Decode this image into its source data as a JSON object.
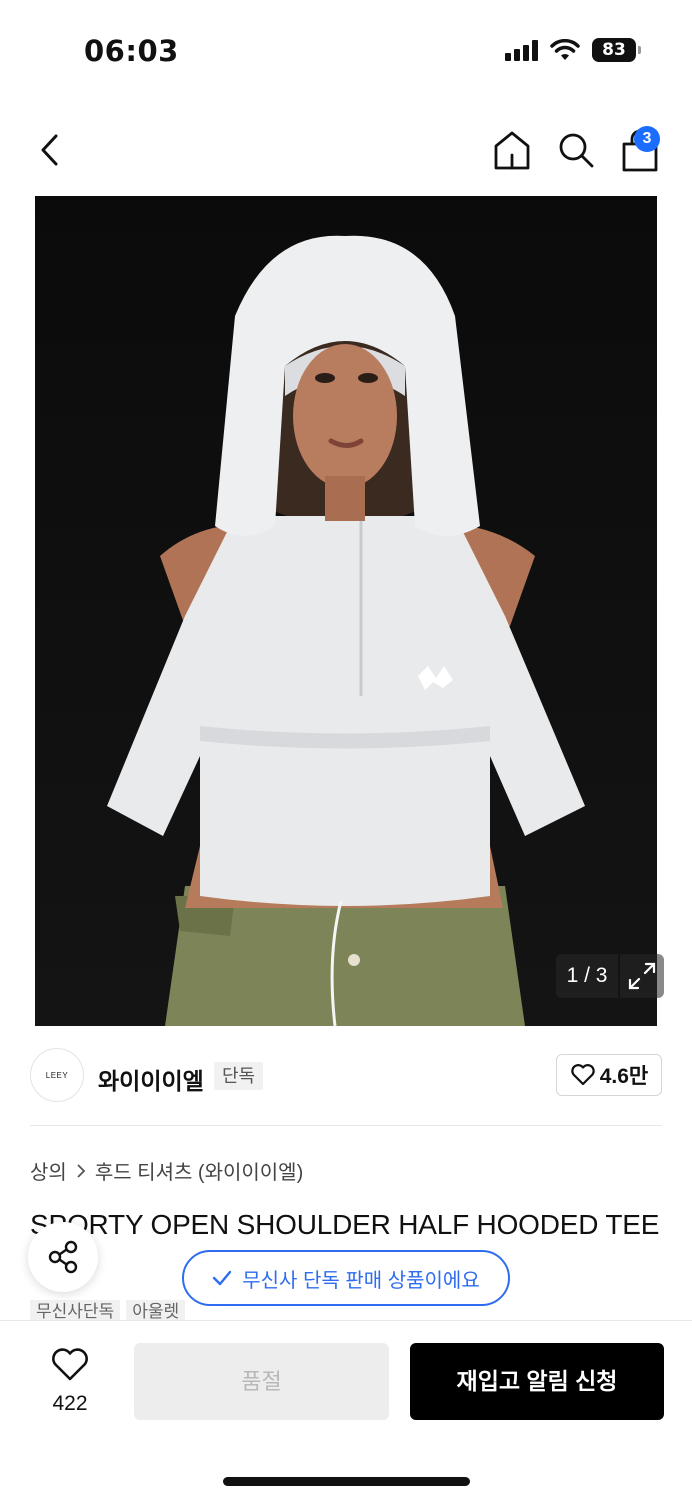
{
  "status": {
    "time": "06:03",
    "battery": "83"
  },
  "nav": {
    "cart_count": "3"
  },
  "gallery": {
    "indicator": "1 / 3"
  },
  "brand": {
    "logo_text": "LEEY",
    "name": "와이이이엘",
    "tag": "단독",
    "likes": "4.6만"
  },
  "breadcrumb": {
    "category": "상의",
    "subcategory": "후드 티셔츠 (와이이이엘)"
  },
  "product": {
    "title": "SPORTY OPEN SHOULDER HALF HOODED TEE",
    "tags": [
      "무신사단독",
      "아울렛"
    ]
  },
  "toast": {
    "label": "무신사 단독 판매 상품이에요"
  },
  "actions": {
    "wish_count": "422",
    "soldout_label": "품절",
    "restock_label": "재입고 알림 신청"
  },
  "colors": {
    "accent": "#2e6cf0",
    "badge": "#1a6dff",
    "primary_button": "#000000",
    "disabled_button": "#ededed"
  }
}
